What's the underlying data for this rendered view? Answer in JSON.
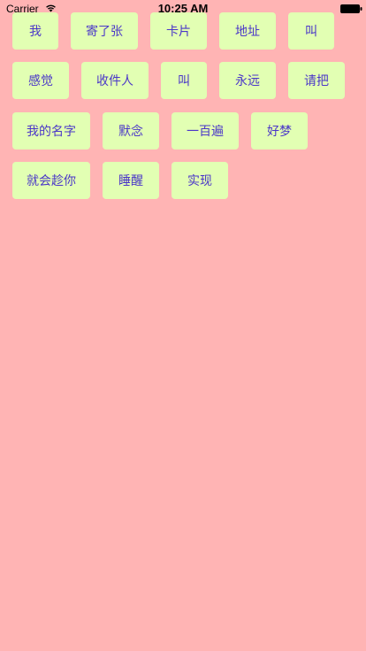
{
  "status_bar": {
    "carrier": "Carrier",
    "time": "10:25 AM",
    "wifi_icon": "wifi-icon",
    "battery_icon": "battery-full-icon"
  },
  "colors": {
    "background": "#ffb4b4",
    "tag_background": "#e2ffb3",
    "tag_text": "#4b37c8"
  },
  "tags": [
    "我",
    "寄了张",
    "卡片",
    "地址",
    "叫",
    "感觉",
    "收件人",
    "叫",
    "永远",
    "请把",
    "我的名字",
    "默念",
    "一百遍",
    "好梦",
    "就会趁你",
    "睡醒",
    "实现"
  ]
}
